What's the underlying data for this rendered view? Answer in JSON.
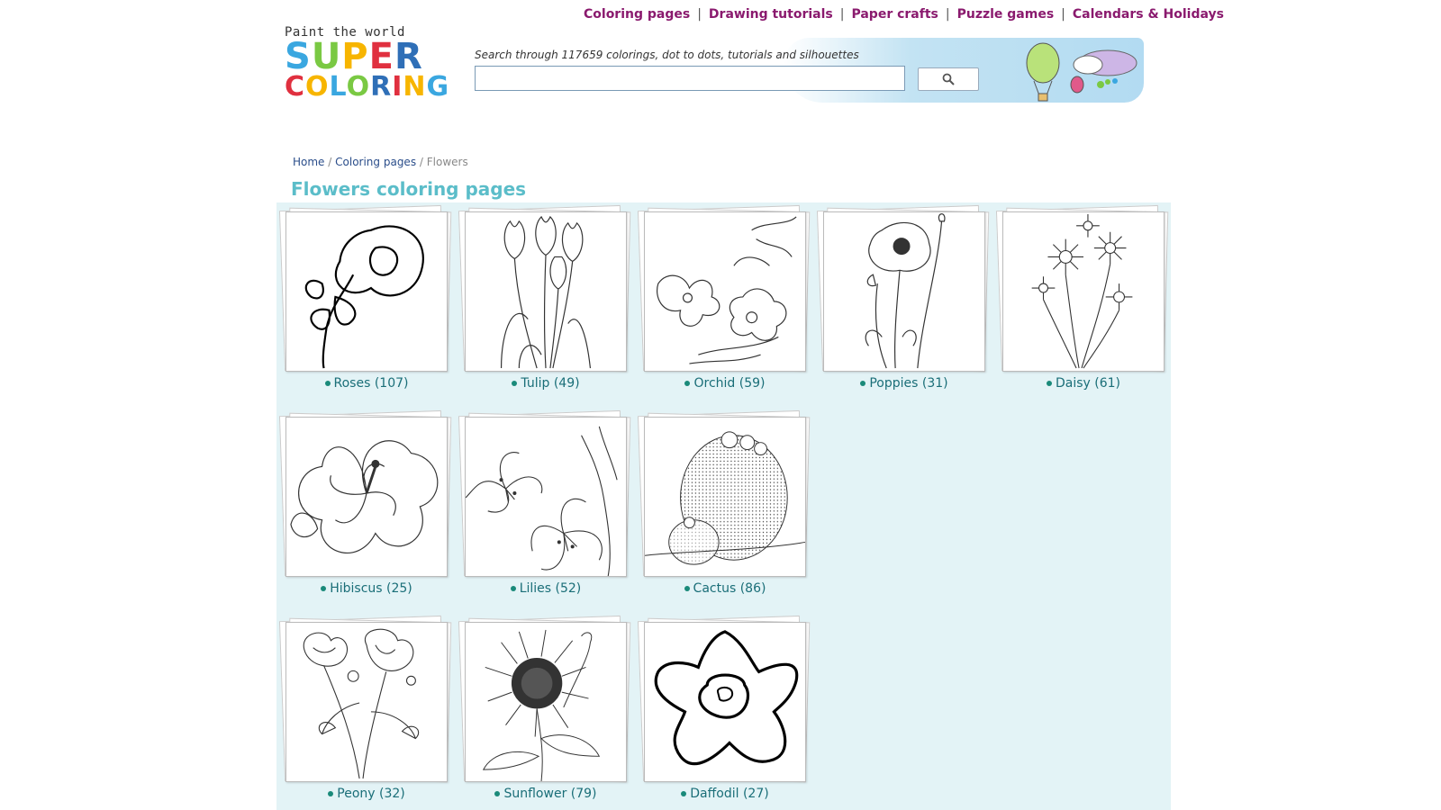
{
  "nav": {
    "items": [
      {
        "label": "Coloring pages"
      },
      {
        "label": "Drawing tutorials"
      },
      {
        "label": "Paper crafts"
      },
      {
        "label": "Puzzle games"
      },
      {
        "label": "Calendars & Holidays"
      }
    ]
  },
  "logo": {
    "tagline": "Paint the world",
    "word1": [
      "S",
      "U",
      "P",
      "E",
      "R"
    ],
    "word2": [
      "C",
      "O",
      "L",
      "O",
      "R",
      "I",
      "N",
      "G"
    ]
  },
  "search": {
    "label": "Search through 117659 colorings, dot to dots, tutorials and silhouettes",
    "value": "",
    "button_icon": "search-icon"
  },
  "breadcrumb": {
    "home": "Home",
    "sep": "/",
    "section": "Coloring pages",
    "current": "Flowers"
  },
  "page_title": "Flowers coloring pages",
  "categories": [
    {
      "label": "Roses (107)",
      "icon": "rose-icon"
    },
    {
      "label": "Tulip (49)",
      "icon": "tulip-icon"
    },
    {
      "label": "Orchid (59)",
      "icon": "orchid-icon"
    },
    {
      "label": "Poppies (31)",
      "icon": "poppy-icon"
    },
    {
      "label": "Daisy (61)",
      "icon": "daisy-icon"
    },
    {
      "label": "Hibiscus (25)",
      "icon": "hibiscus-icon"
    },
    {
      "label": "Lilies (52)",
      "icon": "lily-icon"
    },
    {
      "label": "Cactus (86)",
      "icon": "cactus-icon"
    },
    {
      "label": "Peony (32)",
      "icon": "peony-icon"
    },
    {
      "label": "Sunflower (79)",
      "icon": "sunflower-icon"
    },
    {
      "label": "Daffodil (27)",
      "icon": "daffodil-icon"
    }
  ],
  "colors": {
    "nav": "#8a1a6e",
    "title": "#5bbdc9",
    "label": "#1a6e78",
    "grid_bg": "#e3f3f6"
  }
}
